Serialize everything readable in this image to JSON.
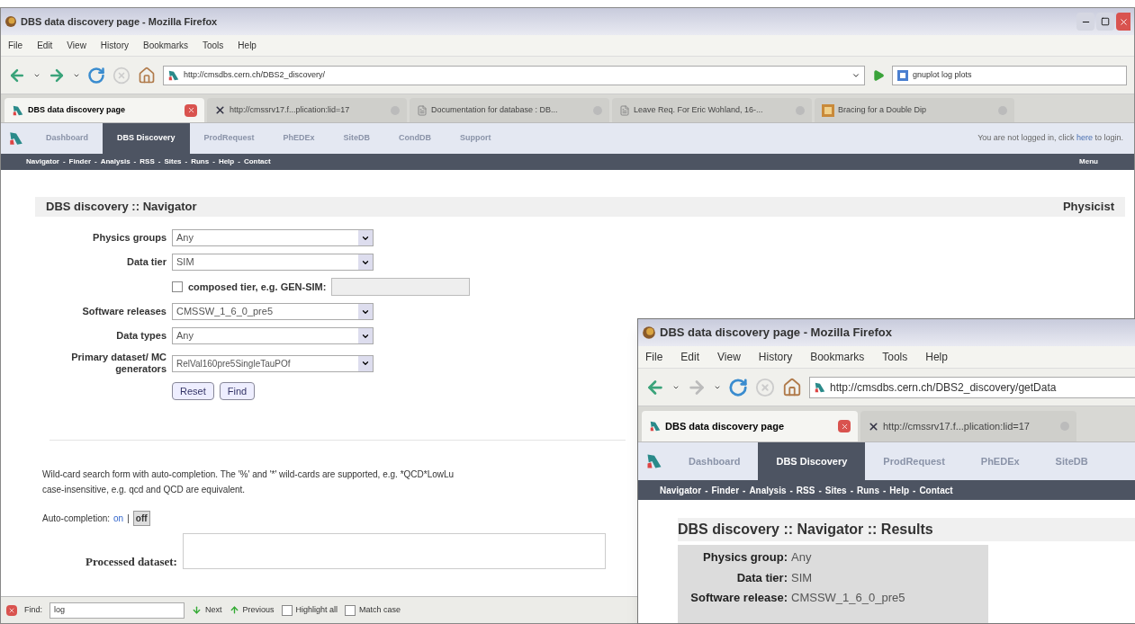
{
  "main_window": {
    "title": "DBS data discovery page - Mozilla Firefox",
    "menu": [
      "File",
      "Edit",
      "View",
      "History",
      "Bookmarks",
      "Tools",
      "Help"
    ],
    "url": "http://cmsdbs.cern.ch/DBS2_discovery/",
    "search": "gnuplot log plots",
    "tabs": [
      {
        "label": "DBS data discovery page",
        "selected": true
      },
      {
        "label": "http://cmssrv17.f...plication:lid=17",
        "selected": false
      },
      {
        "label": "Documentation for database : DB...",
        "selected": false
      },
      {
        "label": "Leave Req. For Eric Wohland, 16-...",
        "selected": false
      },
      {
        "label": "Bracing for a Double Dip",
        "selected": false
      }
    ],
    "site_nav": [
      {
        "label": "Dashboard",
        "selected": false
      },
      {
        "label": "DBS Discovery",
        "selected": true
      },
      {
        "label": "ProdRequest",
        "selected": false
      },
      {
        "label": "PhEDEx",
        "selected": false
      },
      {
        "label": "SiteDB",
        "selected": false
      },
      {
        "label": "CondDB",
        "selected": false
      },
      {
        "label": "Support",
        "selected": false
      }
    ],
    "login": {
      "before": "You are not logged in, click",
      "link": "here",
      "after": "to login."
    },
    "sub_nav": [
      "Navigator",
      "Finder",
      "Analysis",
      "RSS",
      "Sites",
      "Runs",
      "Help",
      "Contact"
    ],
    "separator": "-",
    "sub_nav_right": "Menu",
    "heading": "DBS discovery :: Navigator",
    "role": "Physicist",
    "fields": [
      {
        "label": "Physics groups",
        "value": "Any"
      },
      {
        "label": "Data tier",
        "value": "SIM"
      },
      {
        "label": "Software releases",
        "value": "CMSSW_1_6_0_pre5"
      },
      {
        "label": "Data types",
        "value": "Any"
      },
      {
        "label": "Primary dataset/ MC generators",
        "value": "RelVal160pre5SingleTauPOf"
      }
    ],
    "composed": {
      "label": "composed tier, e.g. GEN-SIM:",
      "checked": false
    },
    "buttons": [
      "Reset",
      "Find"
    ],
    "help_lines": [
      "Wild-card search form with auto-completion. The '%' and '*' wild-cards are supported, e.g. *QCD*LowLu",
      "case-insensitive, e.g. qcd and QCD are equivalent."
    ],
    "autocompletion": {
      "label": "Auto-completion:",
      "separator": "|",
      "options": [
        {
          "label": "on",
          "selected": false
        },
        {
          "label": "off",
          "selected": true
        }
      ]
    },
    "processed_label": "Processed dataset:",
    "find_bar": {
      "label": "Find:",
      "value": "log",
      "next": "Next",
      "previous": "Previous",
      "options": [
        {
          "label": "Highlight all",
          "checked": false
        },
        {
          "label": "Match case",
          "checked": false
        }
      ]
    }
  },
  "second_window": {
    "title": "DBS data discovery page - Mozilla Firefox",
    "menu": [
      "File",
      "Edit",
      "View",
      "History",
      "Bookmarks",
      "Tools",
      "Help"
    ],
    "url": "http://cmsdbs.cern.ch/DBS2_discovery/getData",
    "tabs": [
      {
        "label": "DBS data discovery page",
        "selected": true
      },
      {
        "label": "http://cmssrv17.f...plication:lid=17",
        "selected": false
      }
    ],
    "site_nav": [
      {
        "label": "Dashboard",
        "selected": false
      },
      {
        "label": "DBS Discovery",
        "selected": true
      },
      {
        "label": "ProdRequest",
        "selected": false
      },
      {
        "label": "PhEDEx",
        "selected": false
      },
      {
        "label": "SiteDB",
        "selected": false
      }
    ],
    "sub_nav": [
      "Navigator",
      "Finder",
      "Analysis",
      "RSS",
      "Sites",
      "Runs",
      "Help",
      "Contact"
    ],
    "separator": "-",
    "heading": "DBS discovery :: Navigator :: Results",
    "results": [
      {
        "label": "Physics group:",
        "value": "Any"
      },
      {
        "label": "Data tier:",
        "value": "SIM"
      },
      {
        "label": "Software release:",
        "value": "CMSSW_1_6_0_pre5"
      }
    ]
  }
}
